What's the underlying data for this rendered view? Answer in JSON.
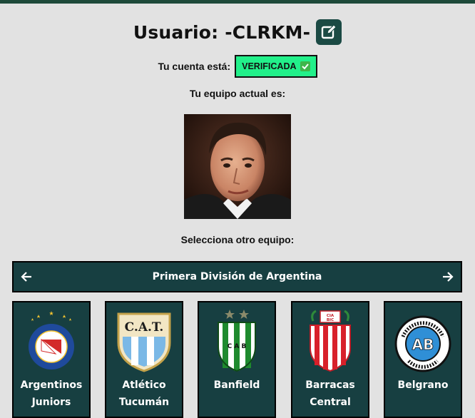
{
  "header": {
    "title": "Usuario: -CLRKM-",
    "edit_icon": "edit-icon"
  },
  "account": {
    "status_label": "Tu cuenta está:",
    "status_badge": "VERIFICADA",
    "status_color": "#22f08a"
  },
  "current_team": {
    "label": "Tu equipo actual es:",
    "image": "team-photo"
  },
  "selector": {
    "label": "Selecciona otro equipo:",
    "league": "Primera División de Argentina",
    "prev_icon": "arrow-left-icon",
    "next_icon": "arrow-right-icon"
  },
  "teams": [
    {
      "line1": "Argentinos",
      "line2": "Juniors"
    },
    {
      "line1": "Atlético",
      "line2": "Tucumán"
    },
    {
      "line1": "Banfield",
      "line2": ""
    },
    {
      "line1": "Barracas",
      "line2": "Central"
    },
    {
      "line1": "Belgrano",
      "line2": ""
    }
  ],
  "colors": {
    "primary": "#173f41",
    "background": "#e2e2e2",
    "topbar": "#1e4a3a"
  }
}
